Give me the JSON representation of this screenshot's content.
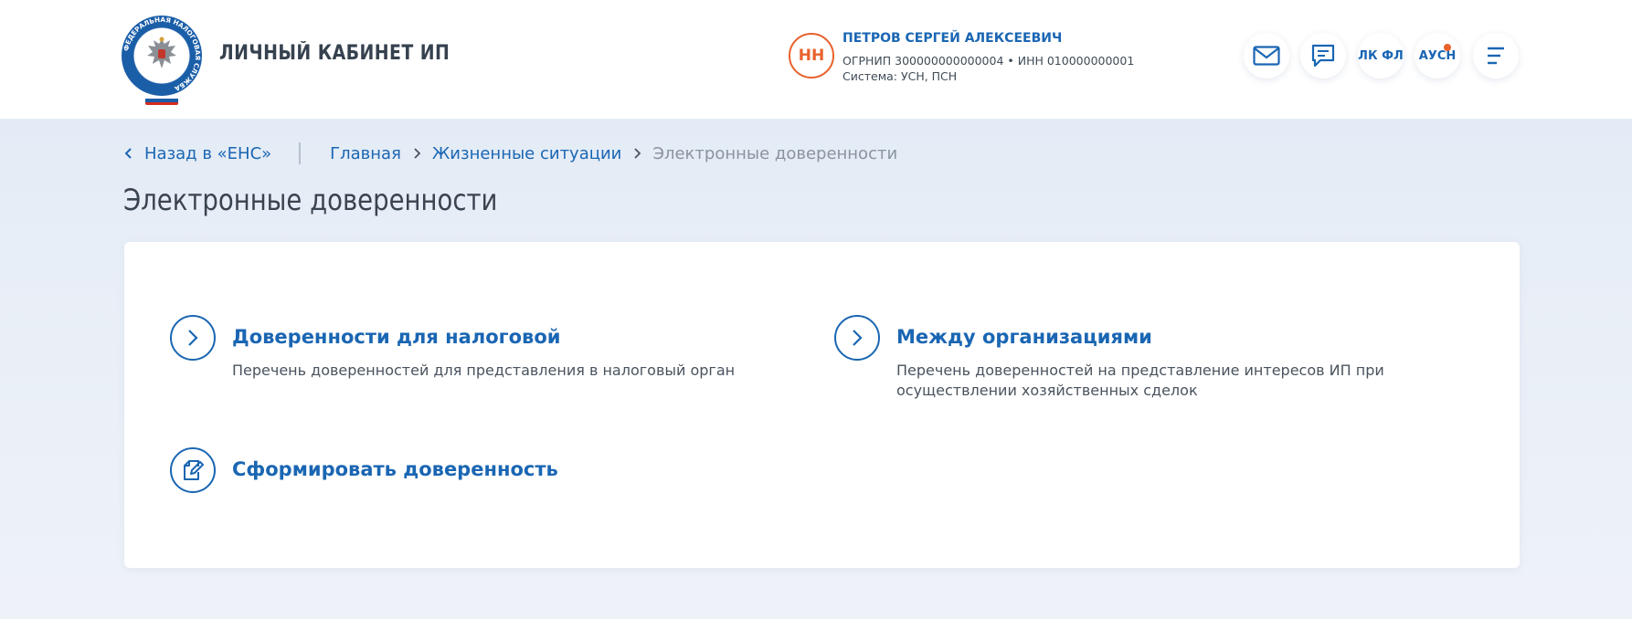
{
  "header": {
    "logo_text": "ФЕДЕРАЛЬНАЯ НАЛОГОВАЯ СЛУЖБА",
    "app_title": "ЛИЧНЫЙ КАБИНЕТ ИП",
    "user": {
      "initials": "НН",
      "name": "ПЕТРОВ СЕРГЕЙ АЛЕКСЕЕВИЧ",
      "ids": "ОГРНИП 300000000000004  •  ИНН 010000000001",
      "system": "Система: УСН, ПСН"
    },
    "buttons": {
      "mail_icon": "mail-icon",
      "chat_icon": "chat-icon",
      "lk_fl": "ЛК ФЛ",
      "ausn": "АУСН",
      "menu_icon": "menu-icon"
    },
    "accent_color": "#1a66b3",
    "notify_color": "#e8612c"
  },
  "breadcrumbs": {
    "back": "Назад в «ЕНС»",
    "items": [
      "Главная",
      "Жизненные ситуации"
    ],
    "current": "Электронные доверенности"
  },
  "page_title": "Электронные доверенности",
  "cards": [
    {
      "icon": "chevron-right-icon",
      "title": "Доверенности для налоговой",
      "description": "Перечень доверенностей для представления в налоговый орган"
    },
    {
      "icon": "chevron-right-icon",
      "title": "Между организациями",
      "description": "Перечень доверенностей на представление интересов ИП при осуществлении хозяйственных сделок"
    },
    {
      "icon": "edit-document-icon",
      "title": "Сформировать доверенность",
      "description": ""
    }
  ]
}
